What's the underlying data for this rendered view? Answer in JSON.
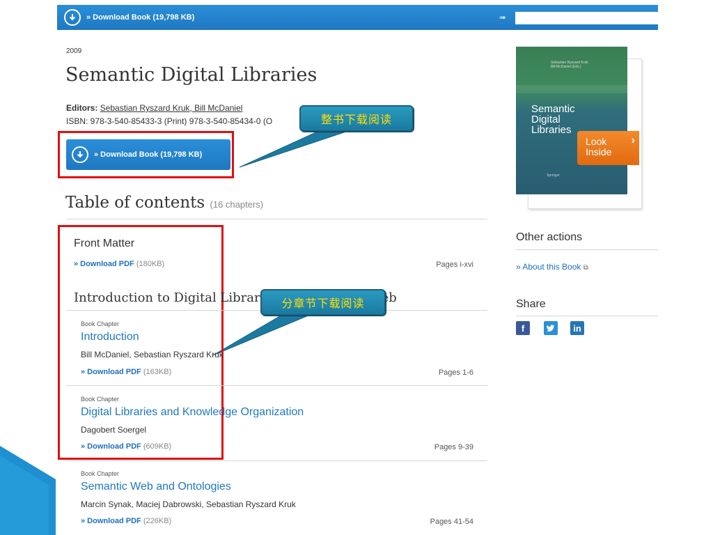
{
  "topbar": {
    "download_label": "» Download Book (19,798 KB)",
    "search_value": ""
  },
  "book": {
    "year": "2009",
    "title": "Semantic Digital Libraries",
    "editors_label": "Editors:",
    "editors": "Sebastian Ryszard Kruk, Bill McDaniel",
    "isbn": "ISBN: 978-3-540-85433-3 (Print) 978-3-540-85434-0 (O",
    "download_label": "» Download Book (19,798 KB)"
  },
  "callouts": {
    "whole_book": "整书下载阅读",
    "by_chapter": "分章节下载阅读"
  },
  "toc": {
    "title": "Table of contents",
    "count": "(16 chapters)",
    "front_matter": {
      "title": "Front Matter",
      "download_label": "» Download PDF",
      "size": "(180KB)",
      "pages": "Pages i-xvi"
    },
    "part_title": "Introduction to Digital Librar",
    "part_title_tail": "eb",
    "chapters": [
      {
        "kind": "Book Chapter",
        "title": "Introduction",
        "authors": "Bill McDaniel, Sebastian Ryszard Kruk",
        "download_label": "» Download PDF",
        "size": "(163KB)",
        "pages": "Pages 1-6"
      },
      {
        "kind": "Book Chapter",
        "title": "Digital Libraries and Knowledge Organization",
        "authors": "Dagobert Soergel",
        "download_label": "» Download PDF",
        "size": "(609KB)",
        "pages": "Pages 9-39"
      },
      {
        "kind": "Book Chapter",
        "title": "Semantic Web and Ontologies",
        "authors": "Marcin Synak, Maciej Dabrowski, Sebastian Ryszard Kruk",
        "download_label": "» Download PDF",
        "size": "(226KB)",
        "pages": "Pages 41-54"
      }
    ]
  },
  "cover": {
    "authors_line1": "Sebastian Ryszard Kruk",
    "authors_line2": "Bill McDaniel (Eds.)",
    "title_l1": "Semantic",
    "title_l2": "Digital",
    "title_l3": "Libraries",
    "publisher": "Springer",
    "look_inside_l1": "Look",
    "look_inside_l2": "Inside"
  },
  "sidebar": {
    "other_actions": "Other actions",
    "about_link": "» About this Book",
    "share": "Share"
  },
  "colors": {
    "brand_blue": "#1f78c1",
    "highlight_red": "#e01010",
    "callout_text": "#ffe000",
    "look_inside_orange": "#e26a10"
  }
}
